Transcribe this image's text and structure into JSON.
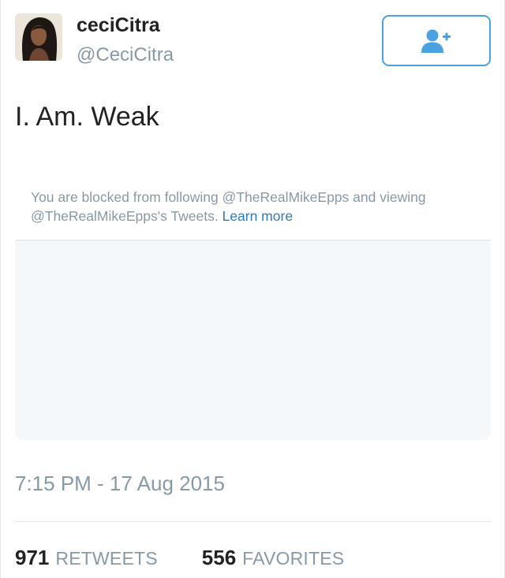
{
  "author": {
    "display_name": "ceciCitra",
    "handle": "@CeciCitra",
    "avatar_icon": "profile-photo"
  },
  "follow_button": {
    "icon": "follow-user-icon",
    "accent_color": "#4aa1e0"
  },
  "tweet": {
    "text": "I. Am. Weak"
  },
  "blocked_notice": {
    "line_text": "You are blocked from following @TheRealMikeEpps and viewing @TheRealMikeEpps's Tweets.",
    "learn_more": "Learn more"
  },
  "timestamp": "7:15 PM - 17 Aug 2015",
  "stats": {
    "retweets_count": "971",
    "retweets_label": "RETWEETS",
    "favorites_count": "556",
    "favorites_label": "FAVORITES"
  }
}
